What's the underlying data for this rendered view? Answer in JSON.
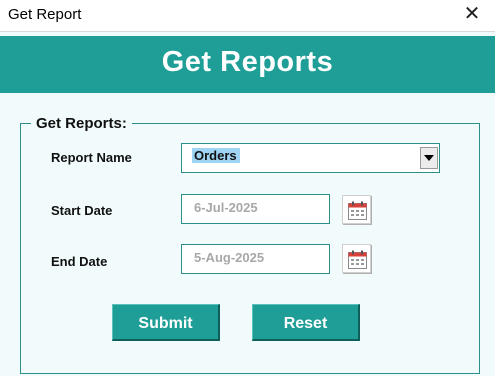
{
  "window": {
    "title": "Get Report",
    "close_symbol": "✕"
  },
  "header": {
    "title": "Get Reports"
  },
  "group": {
    "legend": "Get Reports:"
  },
  "form": {
    "report_name": {
      "label": "Report Name",
      "value": "Orders"
    },
    "start_date": {
      "label": "Start Date",
      "value": "6-Jul-2025"
    },
    "end_date": {
      "label": "End Date",
      "value": "5-Aug-2025"
    }
  },
  "buttons": {
    "submit": "Submit",
    "reset": "Reset"
  },
  "colors": {
    "accent": "#1f9e97",
    "panel_bg": "#f1fbfb",
    "border": "#2b8f8a",
    "selection": "#9fd4f5",
    "date_text": "#a8a8a8"
  }
}
